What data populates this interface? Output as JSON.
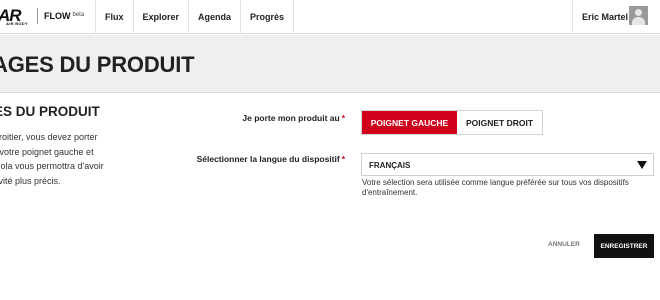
{
  "header": {
    "logo_text": "AR",
    "logo_subtext": "AIR BODY",
    "product": "FLOW",
    "product_badge": "beta",
    "nav": [
      "Flux",
      "Explorer",
      "Agenda",
      "Progrès"
    ],
    "user_name": "Eric Martel",
    "avatar_icon": "user-silhouette-icon"
  },
  "page": {
    "title": "AGES DU PRODUIT"
  },
  "section": {
    "title": "ES DU PRODUIT",
    "description_lines": [
      "droitier, vous devez porter",
      "r votre poignet gauche et",
      "Cola vous permottra d'avoir",
      "tivité plus précis."
    ]
  },
  "form": {
    "wrist_label": "Je porte mon produit au",
    "wrist_options": [
      "POIGNET GAUCHE",
      "POIGNET DROIT"
    ],
    "wrist_selected": "POIGNET GAUCHE",
    "language_label": "Sélectionner la langue du dispositif",
    "language_value": "FRANÇAIS",
    "language_help": "Votre sélection sera utilisée comme langue préférée sur tous vos dispositifs d'entraînement.",
    "required_mark": "*"
  },
  "actions": {
    "cancel": "ANNULER",
    "save": "ENREGISTRER"
  },
  "colors": {
    "accent": "#d0021b",
    "save_button": "#111111",
    "title_band": "#efefef"
  }
}
